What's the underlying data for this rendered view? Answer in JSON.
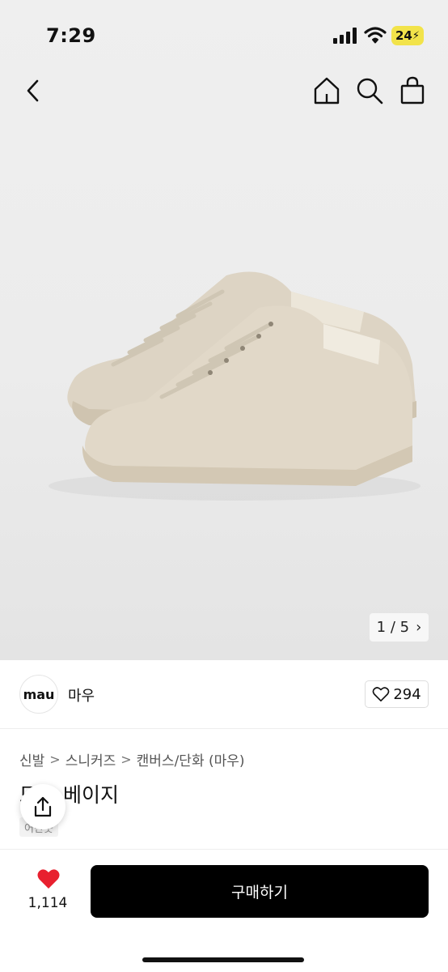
{
  "status_bar": {
    "time": "7:29",
    "battery": "24"
  },
  "product": {
    "image_counter": {
      "current": "1",
      "separator": "/",
      "total": "5"
    },
    "brand": {
      "logo_text": "mau",
      "name": "마우"
    },
    "likes": "294",
    "breadcrumb": [
      "신발",
      "스니커즈",
      "캔버스/단화 (마우)"
    ],
    "breadcrumb_separator": ">",
    "title": "모노 베이지",
    "tag": "어반웃"
  },
  "bottom_bar": {
    "wishlist_count": "1,114",
    "buy_label": "구매하기"
  },
  "colors": {
    "accent_red": "#e8202f",
    "button_black": "#000000",
    "battery_yellow": "#f2e34a"
  }
}
